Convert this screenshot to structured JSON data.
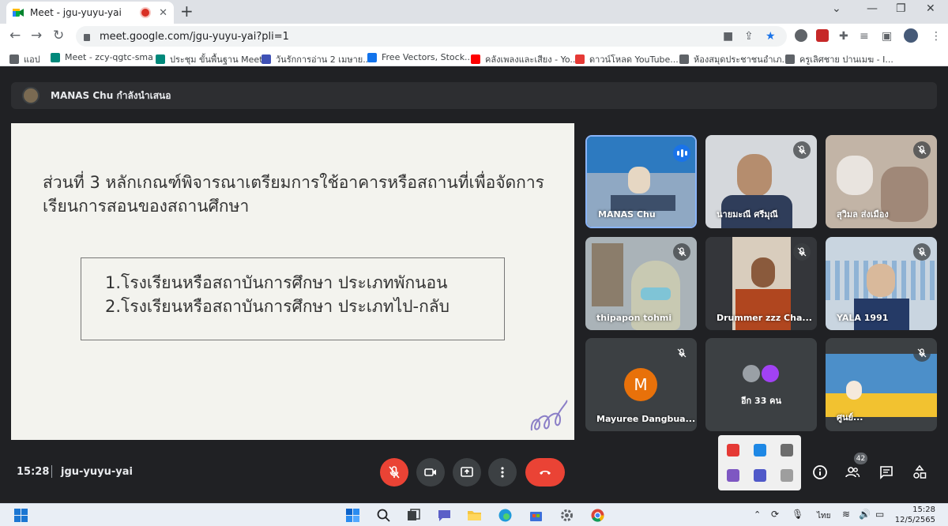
{
  "browser": {
    "tab_title": "Meet - jgu-yuyu-yai",
    "url": "meet.google.com/jgu-yuyu-yai?pli=1",
    "bookmarks": [
      {
        "label": "แอป",
        "icon": "apps-grid-icon",
        "color": "#5f6368"
      },
      {
        "label": "Meet - zcy-qgtc-sma",
        "icon": "meet-icon",
        "color": "#00897b"
      },
      {
        "label": "ประชุม ขั้นพื้นฐาน Meet",
        "icon": "meet-icon",
        "color": "#00897b"
      },
      {
        "label": "วันรักการอ่าน 2 เมษาย...",
        "icon": "forms-icon",
        "color": "#3f51b5"
      },
      {
        "label": "Free Vectors, Stock...",
        "icon": "freepik-icon",
        "color": "#1273eb"
      },
      {
        "label": "คลังเพลงและเสียง - Yo...",
        "icon": "youtube-icon",
        "color": "#ff0000"
      },
      {
        "label": "ดาวน์โหลด YouTube...",
        "icon": "download-icon",
        "color": "#e53935"
      },
      {
        "label": "ห้องสมุดประชาชนอำเภ...",
        "icon": "globe-icon",
        "color": "#5f6368"
      },
      {
        "label": "ครูเลิศชาย ปานเมฆ - I...",
        "icon": "globe-icon",
        "color": "#5f6368"
      }
    ]
  },
  "meet": {
    "presenter_banner": "MANAS Chu กำลังนำเสนอ",
    "slide": {
      "title": "ส่วนที่ 3 หลักเกณฑ์พิจารณาเตรียมการใช้อาคารหรือสถานที่เพื่อจัดการเรียนการสอนของสถานศึกษา",
      "items": [
        "1.โรงเรียนหรือสถาบันการศึกษา ประเภทพักนอน",
        "2.โรงเรียนหรือสถาบันการศึกษา ประเภทไป-กลับ"
      ]
    },
    "participants": [
      {
        "name": "MANAS Chu",
        "bg": "#6f8fb0",
        "speaking": true
      },
      {
        "name": "นายมะณี ศรีมุณี",
        "bg": "#c9ccd1",
        "speaking": false
      },
      {
        "name": "สุวิมล ส่งเมือง",
        "bg": "#b9a99a",
        "speaking": false
      },
      {
        "name": "thipapon tohmi",
        "bg": "#9aa6ad",
        "speaking": false
      },
      {
        "name": "Drummer zzz Cha...",
        "bg": "#8d8b88",
        "speaking": false
      },
      {
        "name": "YALA 1991",
        "bg": "#b7c7d6",
        "speaking": false
      },
      {
        "name": "Mayuree Dangbua...",
        "avatar_letter": "M",
        "avatar_color": "#e8710a",
        "speaking": false
      },
      {
        "name": "อีก 33 คน",
        "speaking": false
      },
      {
        "name": "ศูนย์...",
        "bg": "#4c8fc9",
        "speaking": false
      }
    ],
    "time": "15:28",
    "meeting_code": "jgu-yuyu-yai",
    "people_count": "42"
  },
  "taskbar": {
    "language": "ไทย",
    "time": "15:28",
    "date": "12/5/2565"
  }
}
